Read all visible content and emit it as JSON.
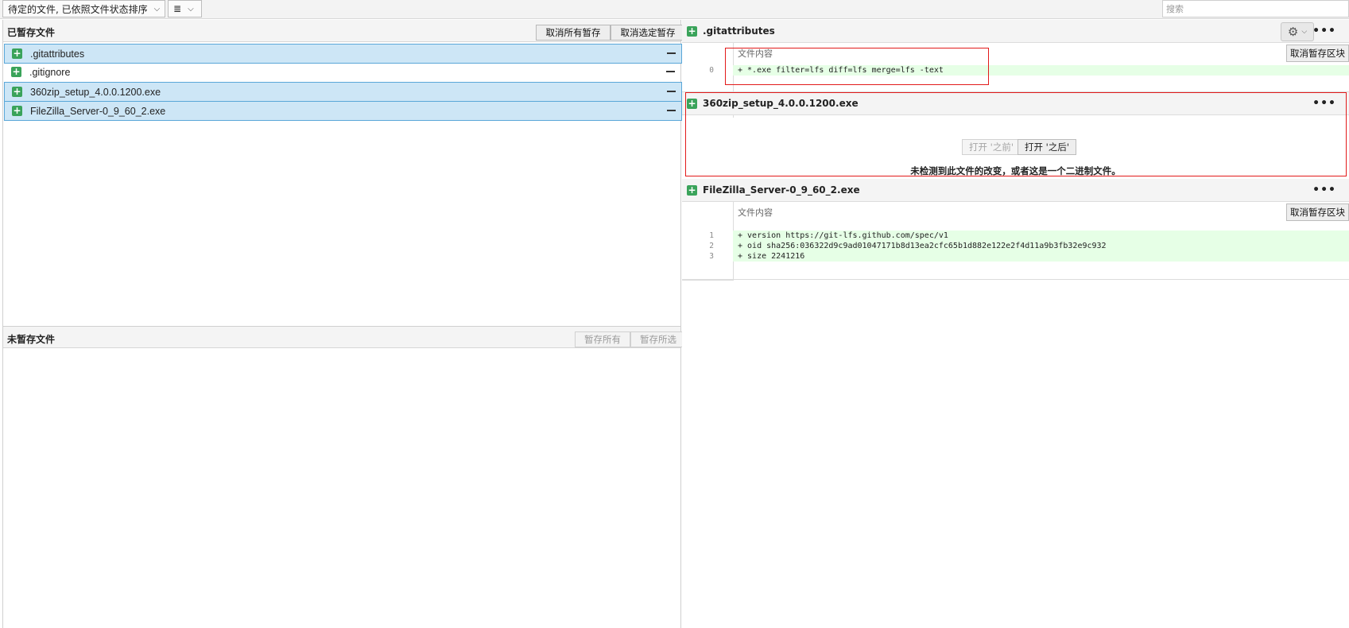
{
  "toolbar": {
    "sort_mode": "待定的文件, 已依照文件状态排序",
    "view_mode_icon": "≣",
    "search_placeholder": "搜索"
  },
  "staged": {
    "title": "已暂存文件",
    "unstage_all": "取消所有暂存",
    "unstage_selected": "取消选定暂存",
    "files": [
      {
        "name": ".gitattributes",
        "selected": true
      },
      {
        "name": ".gitignore",
        "selected": false
      },
      {
        "name": "360zip_setup_4.0.0.1200.exe",
        "selected": true
      },
      {
        "name": "FileZilla_Server-0_9_60_2.exe",
        "selected": true
      }
    ]
  },
  "unstaged": {
    "title": "未暂存文件",
    "stage_all": "暂存所有",
    "stage_selected": "暂存所选"
  },
  "diff": {
    "files": [
      {
        "name": ".gitattributes",
        "hunk_label": "文件内容",
        "unstage_hunk": "取消暂存区块",
        "lines": [
          {
            "no": "0",
            "text": "+ *.exe filter=lfs diff=lfs merge=lfs -text"
          }
        ]
      },
      {
        "name": "360zip_setup_4.0.0.1200.exe",
        "open_before": "打开 '之前'",
        "open_after": "打开 '之后'",
        "message": "未检测到此文件的改变，或者这是一个二进制文件。"
      },
      {
        "name": "FileZilla_Server-0_9_60_2.exe",
        "hunk_label": "文件内容",
        "unstage_hunk": "取消暂存区块",
        "lines": [
          {
            "no": "1",
            "text": "+ version https://git-lfs.github.com/spec/v1"
          },
          {
            "no": "2",
            "text": "+ oid sha256:036322d9c9ad01047171b8d13ea2cfc65b1d882e122e2f4d11a9b3fb32e9c932"
          },
          {
            "no": "3",
            "text": "+ size 2241216"
          }
        ]
      }
    ]
  },
  "icons": {
    "plus": "+",
    "gear": "⚙",
    "more": "•••",
    "chevron": "⌄"
  }
}
